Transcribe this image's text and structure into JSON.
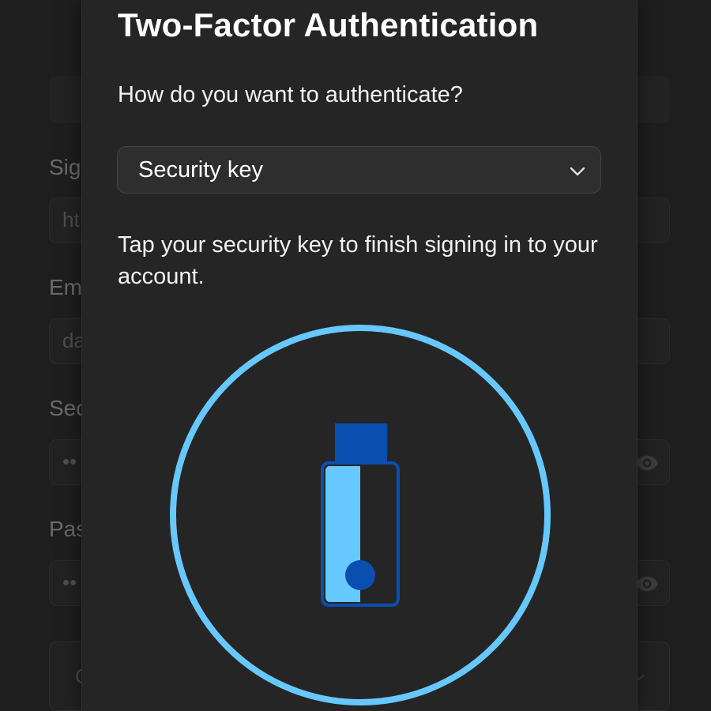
{
  "background_form": {
    "labels": [
      "Sig",
      "Em",
      "Sec",
      "Pas"
    ],
    "field_values": [
      "ht",
      "da",
      "••",
      "••"
    ],
    "select_value": "C"
  },
  "modal": {
    "title": "Two-Factor Authentication",
    "question": "How do you want to authenticate?",
    "method_select": {
      "selected": "Security key"
    },
    "instructions": "Tap your security key to finish signing in to your account."
  },
  "colors": {
    "accent_ring": "#66c8ff",
    "key_cap": "#0a4fb0",
    "key_light": "#66c8ff",
    "modal_bg": "#252525"
  },
  "icons": {
    "select_chevron": "chevron-down-icon",
    "visibility": "eye-icon",
    "illustration": "security-key-icon"
  }
}
